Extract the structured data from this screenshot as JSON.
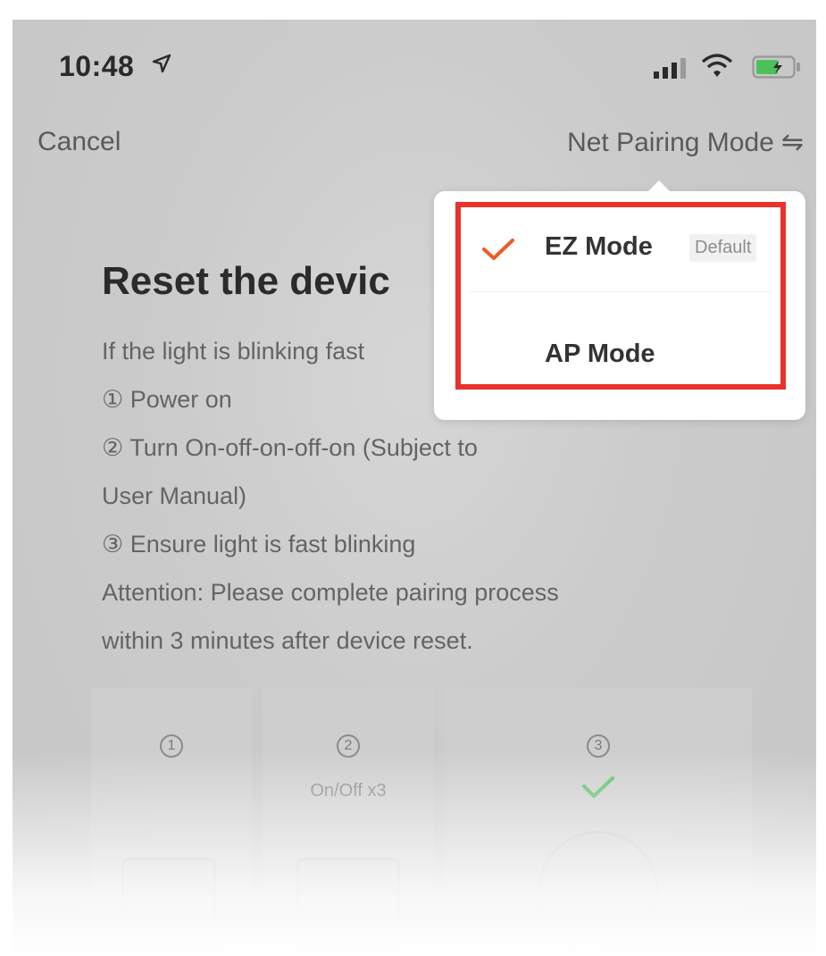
{
  "status_bar": {
    "time": "10:48"
  },
  "nav": {
    "cancel_label": "Cancel",
    "mode_label": "Net Pairing Mode",
    "mode_icon": "⇋"
  },
  "main": {
    "title": "Reset the devic",
    "lines": [
      "If the light is blinking fast",
      "① Power on",
      "② Turn On-off-on-off-on (Subject to",
      "User Manual)",
      "③ Ensure light is fast blinking",
      "Attention: Please complete pairing process",
      "within 3 minutes after device reset."
    ]
  },
  "steps": [
    {
      "number": "1",
      "caption": ""
    },
    {
      "number": "2",
      "caption": "On/Off x3"
    },
    {
      "number": "3",
      "caption": ""
    }
  ],
  "popover": {
    "items": [
      {
        "label": "EZ Mode",
        "badge": "Default",
        "selected": true
      },
      {
        "label": "AP Mode",
        "badge": "",
        "selected": false
      }
    ]
  },
  "colors": {
    "highlight_border": "#e8322c",
    "check_accent": "#f05a28",
    "step_check": "#5cc26a"
  }
}
